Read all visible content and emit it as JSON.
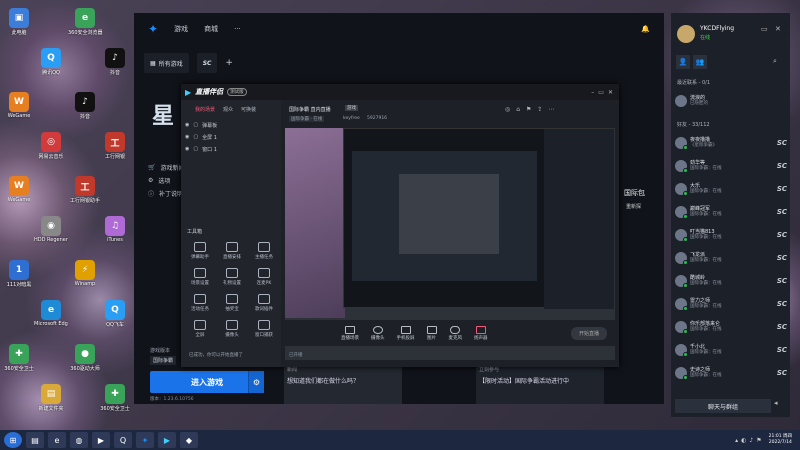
{
  "desktop": {
    "icons": [
      {
        "label": "此电脑",
        "color": "#3b7dd8",
        "glyph": "▣"
      },
      {
        "label": "腾讯QQ",
        "color": "#2a9df4",
        "glyph": "Q"
      },
      {
        "label": "360安全浏览器",
        "color": "#3aa35a",
        "glyph": "e"
      },
      {
        "label": "抖音",
        "color": "#111111",
        "glyph": "♪"
      },
      {
        "label": "WeGame",
        "color": "#e67e22",
        "glyph": "W"
      },
      {
        "label": "网易云音乐",
        "color": "#d13b3b",
        "glyph": "◎"
      },
      {
        "label": "抖音",
        "color": "#111111",
        "glyph": "♪"
      },
      {
        "label": "工行网银",
        "color": "#c0392b",
        "glyph": "工"
      },
      {
        "label": "WeGame",
        "color": "#e67e22",
        "glyph": "W"
      },
      {
        "label": "HDD Regenera...",
        "color": "#888888",
        "glyph": "◉"
      },
      {
        "label": "工行网银助手",
        "color": "#c0392b",
        "glyph": "工"
      },
      {
        "label": "iTunes",
        "color": "#b06ad6",
        "glyph": "♫"
      },
      {
        "label": "111对暗黑",
        "color": "#2e6fd1",
        "glyph": "1"
      },
      {
        "label": "Microsoft Edge",
        "color": "#1f8bd6",
        "glyph": "e"
      },
      {
        "label": "Winamp",
        "color": "#e0a000",
        "glyph": "⚡"
      },
      {
        "label": "QQ飞车",
        "color": "#2a9df4",
        "glyph": "Q"
      },
      {
        "label": "360安全卫士",
        "color": "#3aa35a",
        "glyph": "✚"
      },
      {
        "label": "新建文件夹",
        "color": "#d9a93a",
        "glyph": "▤"
      },
      {
        "label": "360驱动大师",
        "color": "#3aa35a",
        "glyph": "●"
      },
      {
        "label": "360安全卫士",
        "color": "#3aa35a",
        "glyph": "✚"
      }
    ]
  },
  "bnet": {
    "nav": [
      "游戏",
      "商城"
    ],
    "tabs": [
      {
        "label": "所有游戏",
        "icon": "grid-icon"
      },
      {
        "label": "SC",
        "icon": "sc-logo"
      }
    ],
    "game_title": "星",
    "left_menu": [
      "游戏新闻",
      "选项",
      "补丁说明"
    ],
    "version_label": "游戏版本",
    "region": "国际争霸",
    "play_button": "进入游戏",
    "build": "版本：1.23.6.10756",
    "news_a_title": "新闻",
    "news_a_sub": "想知道我们都在做什么吗？",
    "news_b_title": "立刻参与",
    "news_b_sub": "【限时活动】国际争霸活动进行中",
    "side_text": "国际包",
    "side_text2": "重新探"
  },
  "friends": {
    "user": "YKCDFlying",
    "status": "在线",
    "group1": "最近联系 - 0/1",
    "pinned_name": "流浪的",
    "pinned_sub": "已隐匿的",
    "group2": "好友 - 33/112",
    "list": [
      {
        "name": "夜夜撸撸",
        "sub": "《星际争霸》"
      },
      {
        "name": "劲华等",
        "sub": "国际争霸：在线"
      },
      {
        "name": "大乐",
        "sub": "国际争霸：在线"
      },
      {
        "name": "巅峰冠军",
        "sub": "国际争霸：在线"
      },
      {
        "name": "叮当猫813",
        "sub": "国际争霸：在线"
      },
      {
        "name": "飞龙派",
        "sub": "国际争霸：在线"
      },
      {
        "name": "酷城岭",
        "sub": "国际争霸：在线"
      },
      {
        "name": "雷力之师",
        "sub": "国际争霸：在线"
      },
      {
        "name": "你乐部落来仑",
        "sub": "国际争霸：在线"
      },
      {
        "name": "千小北",
        "sub": "国际争霸：在线"
      },
      {
        "name": "史诗之师",
        "sub": "国际争霸：在线"
      }
    ],
    "chat_button": "聊天与群组"
  },
  "stream": {
    "title": "直播伴侣",
    "badge": "测试版",
    "tabs": [
      "我的场景",
      "观众",
      "可换装"
    ],
    "sources": [
      "弹幕板",
      "全屏 1",
      "窗口 1"
    ],
    "toolbox": "工具箱",
    "tools": [
      "弹幕助手",
      "直播安排",
      "主播任务",
      "场景设置",
      "礼物设置",
      "连麦PK",
      "活动任务",
      "抽奖宝",
      "歌词插件",
      "全屏",
      "摄像头",
      "窗口捕获"
    ],
    "status_text": "已开播",
    "scene_title": "国际争霸 直内直播",
    "scene_badge": "游戏",
    "scene_meta": "国际争霸 · 在线",
    "viewer_name": "keyfree",
    "viewer_id": "5927916",
    "controls": [
      "直播场景",
      "摄像头",
      "手机投屏",
      "图片",
      "麦克风",
      "扬声器"
    ],
    "start_button": "开始直播",
    "tip": "已成功，你可以开始直播了"
  },
  "taskbar": {
    "time": "21:01 周四",
    "date": "2022/7/14"
  }
}
